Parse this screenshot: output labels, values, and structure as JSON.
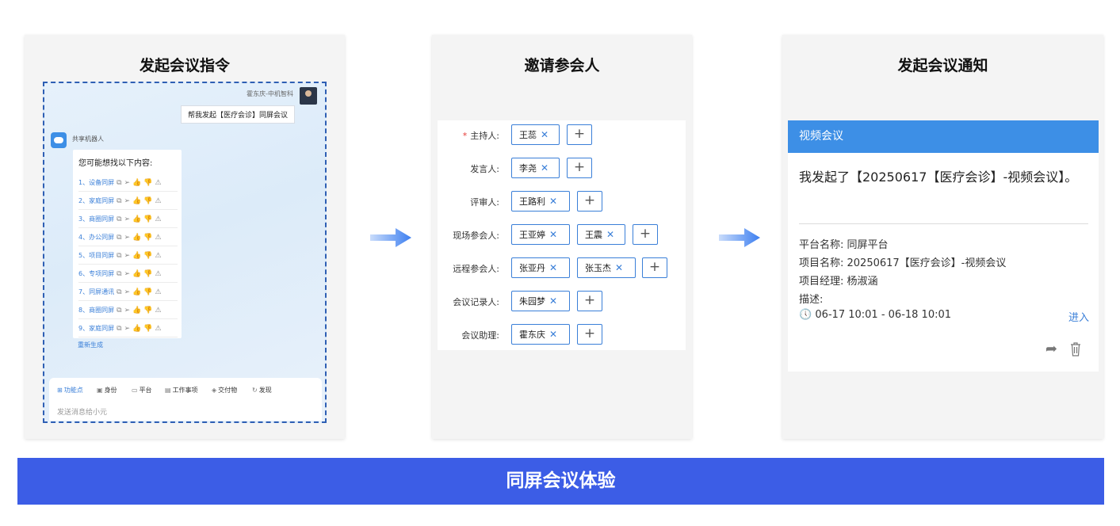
{
  "colors": {
    "accent": "#3d8fe6",
    "banner": "#3c5de6",
    "link": "#3a7fd8",
    "required": "#e53935"
  },
  "panel1": {
    "title": "发起会议指令",
    "user_name": "霍东庆-中机智科",
    "user_message": "帮我发起【医疗会诊】同屏会议",
    "bot_name": "共享机器人",
    "bot_prompt": "您可能想找以下内容:",
    "suggestions": [
      "1、设备同屏",
      "2、家庭同屏",
      "3、商圈同屏",
      "4、办公同屏",
      "5、项目同屏",
      "6、专项同屏",
      "7、同屏通讯",
      "8、商圈同屏",
      "9、家庭同屏"
    ],
    "suggestion_icons": [
      "copy-icon",
      "send-icon",
      "thumbs-up-icon",
      "thumbs-down-icon",
      "warning-icon"
    ],
    "regenerate": "重新生成",
    "tools": [
      "功能点",
      "身份",
      "平台",
      "工作事项",
      "交付物",
      "发现"
    ],
    "input_placeholder": "发送消息给小元"
  },
  "panel2": {
    "title": "邀请参会人",
    "rows": [
      {
        "label": "主持人:",
        "required": true,
        "people": [
          "王蕊"
        ]
      },
      {
        "label": "发言人:",
        "required": false,
        "people": [
          "李尧"
        ]
      },
      {
        "label": "评审人:",
        "required": false,
        "people": [
          "王路利"
        ]
      },
      {
        "label": "现场参会人:",
        "required": false,
        "people": [
          "王亚婷",
          "王震"
        ]
      },
      {
        "label": "远程参会人:",
        "required": false,
        "people": [
          "张亚丹",
          "张玉杰"
        ]
      },
      {
        "label": "会议记录人:",
        "required": false,
        "people": [
          "朱园梦"
        ]
      },
      {
        "label": "会议助理:",
        "required": false,
        "people": [
          "霍东庆"
        ]
      }
    ],
    "required_mark": "*",
    "remove_symbol": "✕",
    "add_symbol": "+"
  },
  "panel3": {
    "title": "发起会议通知",
    "header": "视频会议",
    "body": "我发起了【20250617【医疗会诊】-视频会议】。",
    "platform": "平台名称: 同屏平台",
    "project": "项目名称: 20250617【医疗会诊】-视频会议",
    "manager": "项目经理: 杨淑涵",
    "description": "描述:",
    "time": "06-17 10:01 - 06-18 10:01",
    "enter": "进入"
  },
  "banner": "同屏会议体验"
}
